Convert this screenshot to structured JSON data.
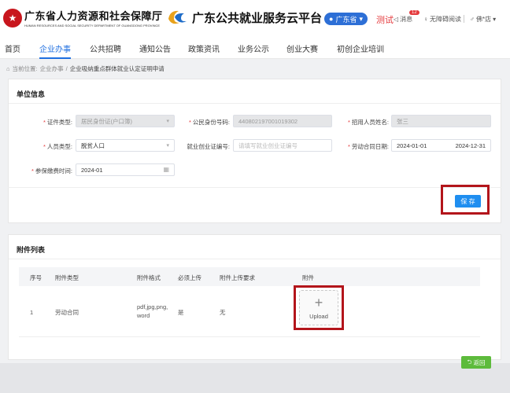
{
  "header": {
    "logo1_cn": "广东省人力资源和社会保障厅",
    "logo1_en": "HUMAN RESOURCES AND SOCIAL SECURITY DEPARTMENT OF GUANGDONG PROVINCE",
    "logo2_cn": "广东公共就业服务云平台",
    "region": "广东省",
    "test_label": "测试",
    "messages_label": "消息",
    "messages_count": "12",
    "accessibility_label": "无障碍阅读",
    "user_label": "佛*店"
  },
  "nav": {
    "items": [
      "首页",
      "企业办事",
      "公共招聘",
      "通知公告",
      "政策资讯",
      "业务公示",
      "创业大赛",
      "初创企业培训"
    ],
    "active_index": 1
  },
  "breadcrumb": {
    "prefix": "当前位置:",
    "level1": "企业办事",
    "separator": "/",
    "current": "企业吸纳重点群体就业认定证明申请"
  },
  "unit_info": {
    "title": "单位信息",
    "fields": {
      "id_type_label": "证件类型:",
      "id_type_value": "居民身份证(户口簿)",
      "citizen_id_label": "公民身份号码:",
      "citizen_id_value": "440802197001019302",
      "employee_name_label": "招用人员姓名:",
      "employee_name_value": "张三",
      "person_type_label": "人员类型:",
      "person_type_value": "脱贫人口",
      "employment_cert_label": "就业创业证编号:",
      "employment_cert_placeholder": "请填写就业创业证编号",
      "contract_date_label": "劳动合同日期:",
      "contract_start": "2024-01-01",
      "contract_end": "2024-12-31",
      "insurance_time_label": "参保缴费时间:",
      "insurance_time_value": "2024-01"
    },
    "save_label": "保 存"
  },
  "attachments": {
    "title": "附件列表",
    "columns": [
      "序号",
      "附件类型",
      "附件格式",
      "必须上传",
      "附件上传要求",
      "附件"
    ],
    "rows": [
      {
        "index": "1",
        "type": "劳动合同",
        "format": "pdf,jpg,png,word",
        "required": "是",
        "requirement": "无",
        "upload_label": "Upload"
      }
    ]
  },
  "footer": {
    "back_label": "返回"
  },
  "colors": {
    "primary": "#1f6fe0",
    "save_button": "#1f8ef0",
    "back_button": "#5dbb3c",
    "highlight": "#b3151b",
    "required": "#e4393c"
  }
}
